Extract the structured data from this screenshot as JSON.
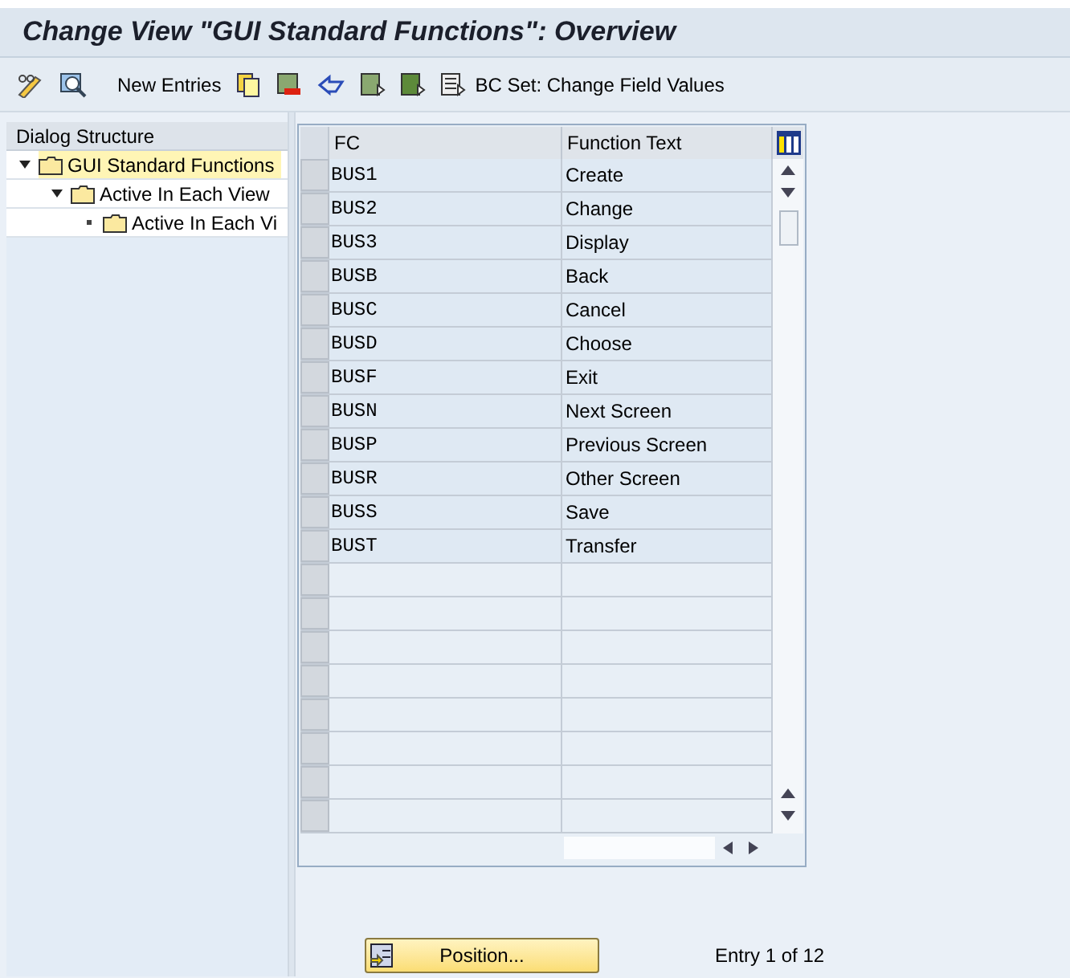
{
  "window": {
    "title": "Change View \"GUI Standard Functions\": Overview"
  },
  "toolbar": {
    "buttons": [
      "New Entries",
      "BC Set: Change Field Values"
    ]
  },
  "dialog_structure": {
    "title": "Dialog Structure",
    "tree": [
      {
        "label": "GUI Standard Functions",
        "expanded": true,
        "selected": true,
        "children": [
          {
            "label": "Active In Each View",
            "expanded": true,
            "selected": false,
            "children": [
              {
                "label": "Active In Each Vi",
                "selected": false
              }
            ]
          }
        ]
      }
    ]
  },
  "table": {
    "columns": [
      "FC",
      "Function Text"
    ],
    "rows": [
      [
        "BUS1",
        "Create"
      ],
      [
        "BUS2",
        "Change"
      ],
      [
        "BUS3",
        "Display"
      ],
      [
        "BUSB",
        "Back"
      ],
      [
        "BUSC",
        "Cancel"
      ],
      [
        "BUSD",
        "Choose"
      ],
      [
        "BUSF",
        "Exit"
      ],
      [
        "BUSN",
        "Next Screen"
      ],
      [
        "BUSP",
        "Previous Screen"
      ],
      [
        "BUSR",
        "Other Screen"
      ],
      [
        "BUSS",
        "Save"
      ],
      [
        "BUST",
        "Transfer"
      ]
    ]
  },
  "position_button": "Position...",
  "entry_info": "Entry 1 of 12"
}
